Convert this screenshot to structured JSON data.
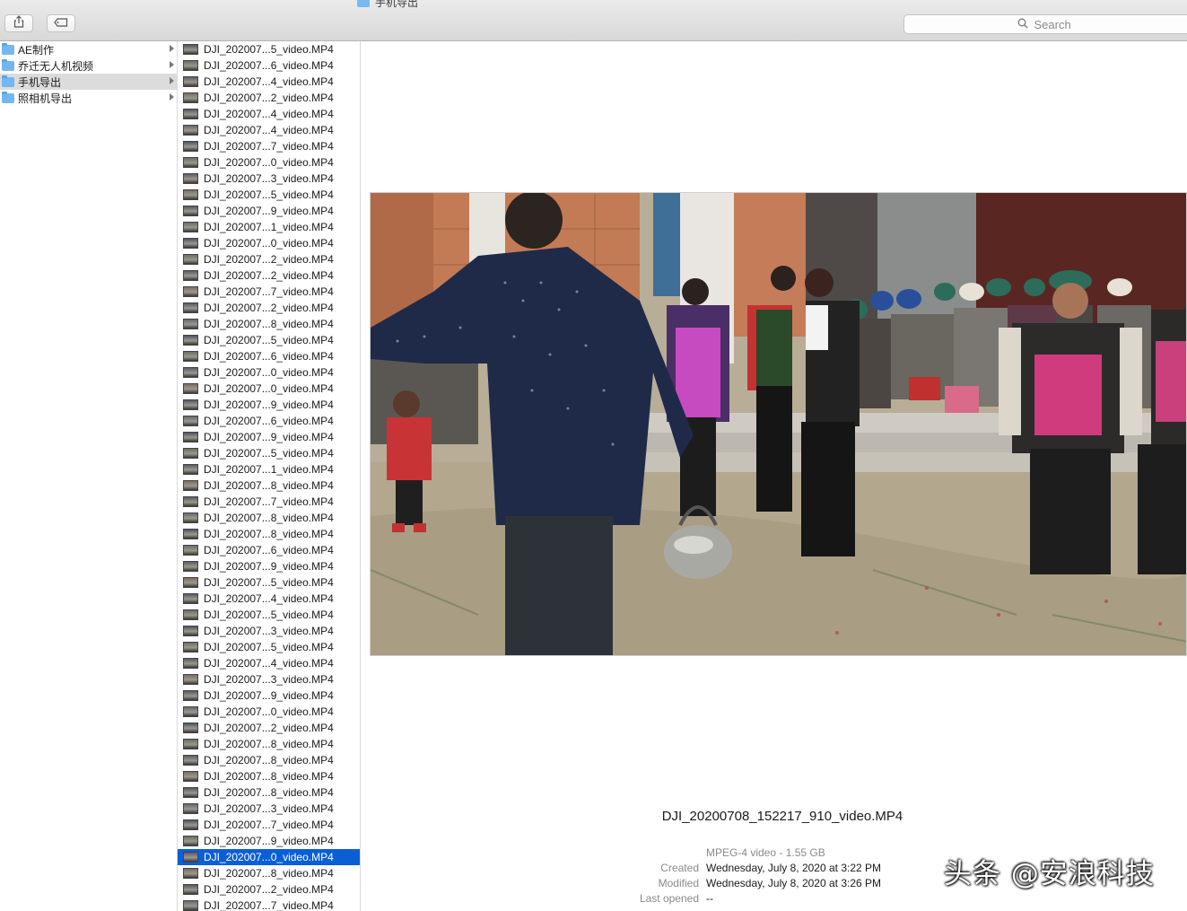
{
  "window": {
    "title": "手机导出"
  },
  "toolbar": {
    "share_icon": "share-icon",
    "tag_icon": "tag-icon"
  },
  "search": {
    "placeholder": "Search",
    "icon": "magnifier-icon"
  },
  "sidebar": {
    "items": [
      {
        "label": "AE制作",
        "selected": false
      },
      {
        "label": "乔迁无人机视频",
        "selected": false
      },
      {
        "label": "手机导出",
        "selected": true
      },
      {
        "label": "照相机导出",
        "selected": false
      }
    ]
  },
  "files": [
    "DJI_202007...5_video.MP4",
    "DJI_202007...6_video.MP4",
    "DJI_202007...4_video.MP4",
    "DJI_202007...2_video.MP4",
    "DJI_202007...4_video.MP4",
    "DJI_202007...4_video.MP4",
    "DJI_202007...7_video.MP4",
    "DJI_202007...0_video.MP4",
    "DJI_202007...3_video.MP4",
    "DJI_202007...5_video.MP4",
    "DJI_202007...9_video.MP4",
    "DJI_202007...1_video.MP4",
    "DJI_202007...0_video.MP4",
    "DJI_202007...2_video.MP4",
    "DJI_202007...2_video.MP4",
    "DJI_202007...7_video.MP4",
    "DJI_202007...2_video.MP4",
    "DJI_202007...8_video.MP4",
    "DJI_202007...5_video.MP4",
    "DJI_202007...6_video.MP4",
    "DJI_202007...0_video.MP4",
    "DJI_202007...0_video.MP4",
    "DJI_202007...9_video.MP4",
    "DJI_202007...6_video.MP4",
    "DJI_202007...9_video.MP4",
    "DJI_202007...5_video.MP4",
    "DJI_202007...1_video.MP4",
    "DJI_202007...8_video.MP4",
    "DJI_202007...7_video.MP4",
    "DJI_202007...8_video.MP4",
    "DJI_202007...8_video.MP4",
    "DJI_202007...6_video.MP4",
    "DJI_202007...9_video.MP4",
    "DJI_202007...5_video.MP4",
    "DJI_202007...4_video.MP4",
    "DJI_202007...5_video.MP4",
    "DJI_202007...3_video.MP4",
    "DJI_202007...5_video.MP4",
    "DJI_202007...4_video.MP4",
    "DJI_202007...3_video.MP4",
    "DJI_202007...9_video.MP4",
    "DJI_202007...0_video.MP4",
    "DJI_202007...2_video.MP4",
    "DJI_202007...8_video.MP4",
    "DJI_202007...8_video.MP4",
    "DJI_202007...8_video.MP4",
    "DJI_202007...8_video.MP4",
    "DJI_202007...3_video.MP4",
    "DJI_202007...7_video.MP4",
    "DJI_202007...9_video.MP4",
    "DJI_202007...0_video.MP4",
    "DJI_202007...8_video.MP4",
    "DJI_202007...2_video.MP4",
    "DJI_202007...7_video.MP4"
  ],
  "selected_file_index": 50,
  "preview": {
    "filename": "DJI_20200708_152217_910_video.MP4",
    "kind": "MPEG-4 video - 1.55 GB",
    "meta": [
      {
        "key": "Created",
        "value": "Wednesday, July 8, 2020 at 3:22 PM"
      },
      {
        "key": "Modified",
        "value": "Wednesday, July 8, 2020 at 3:26 PM"
      },
      {
        "key": "Last opened",
        "value": "--"
      }
    ]
  },
  "watermark": "头条 @安浪科技"
}
